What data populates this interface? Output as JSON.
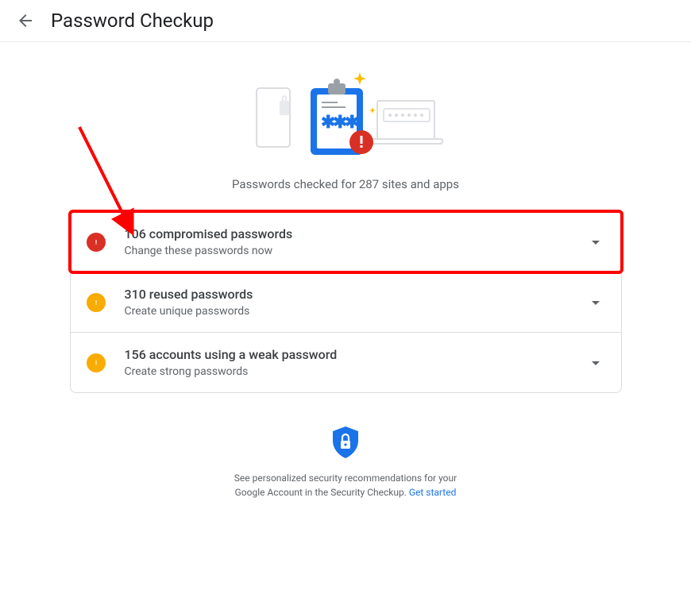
{
  "header": {
    "title": "Password Checkup"
  },
  "summary": {
    "checked_text": "Passwords checked for 287 sites and apps"
  },
  "cards": [
    {
      "title": "106 compromised passwords",
      "subtitle": "Change these passwords now",
      "severity": "red",
      "highlighted": true
    },
    {
      "title": "310 reused passwords",
      "subtitle": "Create unique passwords",
      "severity": "yellow",
      "highlighted": false
    },
    {
      "title": "156 accounts using a weak password",
      "subtitle": "Create strong passwords",
      "severity": "yellow",
      "highlighted": false
    }
  ],
  "footer": {
    "text_line1": "See personalized security recommendations for your",
    "text_line2": "Google Account in the Security Checkup. ",
    "link_text": "Get started"
  }
}
